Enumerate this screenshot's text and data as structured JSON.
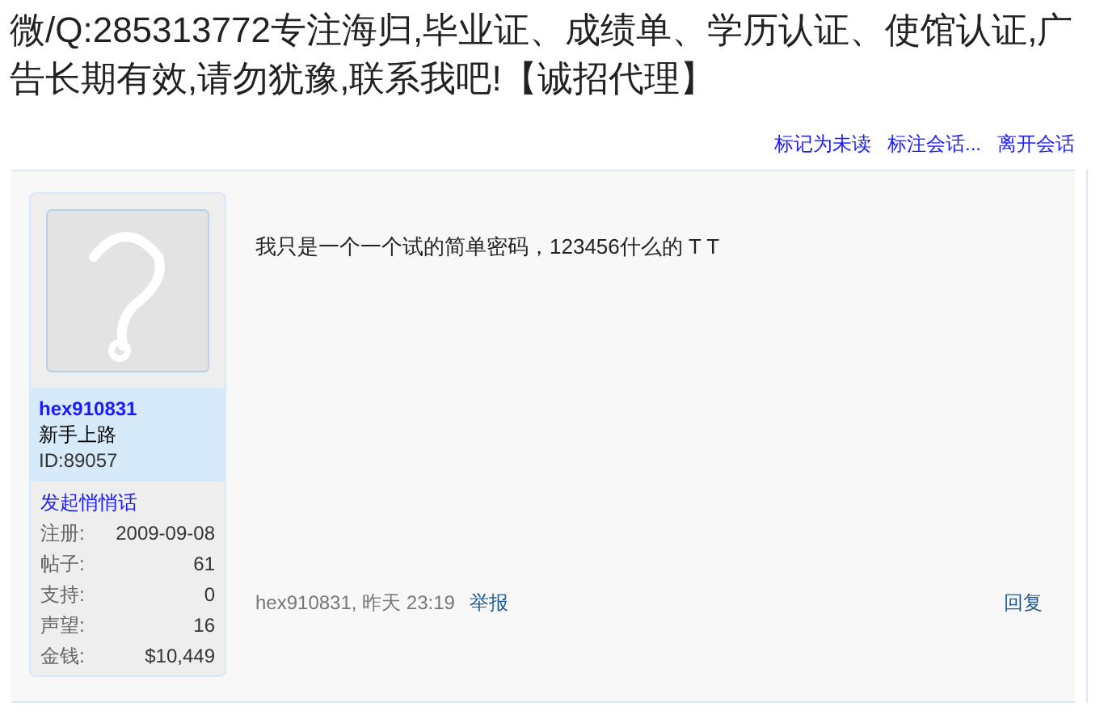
{
  "thread_title": "微/Q:285313772专注海归,毕业证、成绩单、学历认证、使馆认证,广告长期有效,请勿犹豫,联系我吧!【诚招代理】",
  "actions": [
    "标记为未读",
    "标注会话...",
    "离开会话"
  ],
  "post": {
    "author": {
      "username": "hex910831",
      "rank": "新手上路",
      "user_id": "ID:89057",
      "pm_link": "发起悄悄话",
      "stats": [
        {
          "label": "注册:",
          "value": "2009-09-08"
        },
        {
          "label": "帖子:",
          "value": "61"
        },
        {
          "label": "支持:",
          "value": "0"
        },
        {
          "label": "声望:",
          "value": "16"
        },
        {
          "label": "金钱:",
          "value": "$10,449"
        }
      ]
    },
    "message": "我只是一个一个试的简单密码，123456什么的 T T",
    "meta": "hex910831, 昨天 23:19",
    "report": "举报",
    "reply": "回复"
  }
}
